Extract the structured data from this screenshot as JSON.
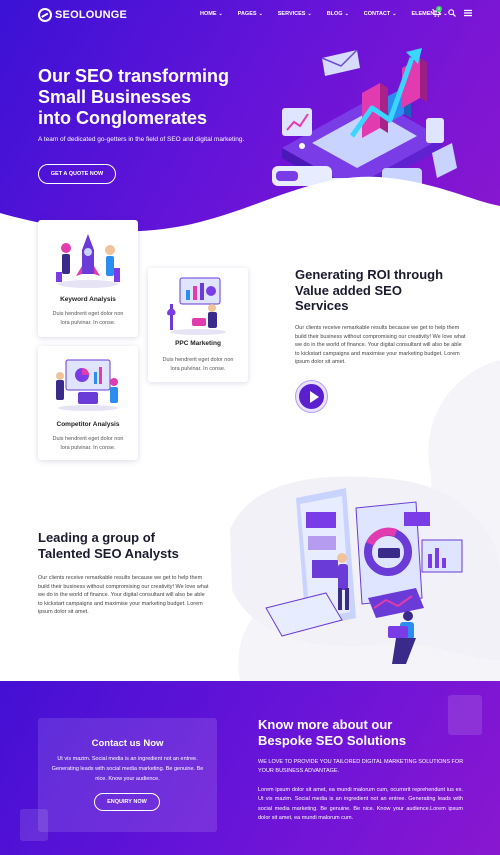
{
  "brand": {
    "name": "SEOLOUNGE"
  },
  "nav": {
    "items": [
      {
        "label": "HOME"
      },
      {
        "label": "PAGES"
      },
      {
        "label": "SERVICES"
      },
      {
        "label": "BLOG"
      },
      {
        "label": "CONTACT"
      },
      {
        "label": "ELEMENTS"
      }
    ],
    "cart_count": "0",
    "icons": [
      "cart-icon",
      "search-icon",
      "menu-icon"
    ]
  },
  "hero": {
    "title_line1": "Our SEO transforming",
    "title_line2": "Small Businesses",
    "title_line3": "into Conglomerates",
    "subtitle": "A team of dedicated go-getters in the field of SEO and digital marketing.",
    "button": "GET A QUOTE NOW"
  },
  "services": [
    {
      "title": "Keyword Analysis",
      "text": "Duis hendrerit eget dolor non lora pulvinar. In conse."
    },
    {
      "title": "PPC Marketing",
      "text": "Duis hendrerit eget dolor non lora pulvinar. In conse."
    },
    {
      "title": "Competitor Analysis",
      "text": "Duis hendrerit eget dolor non lora pulvinar. In conse."
    }
  ],
  "roi": {
    "title_line1": "Generating ROI through",
    "title_line2": "Value added SEO",
    "title_line3": "Services",
    "text": "Our clients receive remarkable results because we get to help them build their business without compromising our creativity! We love what we do in the world of finance. Your digital consultant will also be able to kickstart campaigns and maximise your marketing budget. Lorem ipsum dolor sit amet."
  },
  "team": {
    "title_line1": "Leading a group of",
    "title_line2": "Talented SEO Analysts",
    "text": "Our clients receive remarkable results because we get to help them build their business without compromising our creativity! We love what we do in the world of finance. Your digital consultant will also be able to kickstart campaigns and maximise your marketing budget. Lorem ipsum dolor sit amet."
  },
  "contact": {
    "title": "Contact us Now",
    "text": "Ut vis mazim. Social media is an ingredient not an entree. Generating leads with social media marketing. Be genuine. Be nice. Know your audience.",
    "button": "ENQUIRY NOW"
  },
  "bespoke": {
    "title_line1": "Know more about our",
    "title_line2": "Bespoke SEO Solutions",
    "subtitle": "WE LOVE TO PROVIDE YOU TAILORED DIGITAL MARKETING SOLUTIONS FOR YOUR BUSINESS ADVANTAGE.",
    "text": "Lorem ipsum dolor sit amet, ea mundi malorum cum, ocurrerit reprehendunt ius ex. Ut vis mazim. Social media is an ingredient not an entree. Generating leads with social media marketing. Be genuine. Be nice. Know your audience.Lorem ipsum dolor sit amet, ea mundi malorum cum."
  },
  "colors": {
    "primary": "#5a1fcf",
    "accent_pink": "#e23bb0",
    "dark": "#1b1b2f"
  }
}
